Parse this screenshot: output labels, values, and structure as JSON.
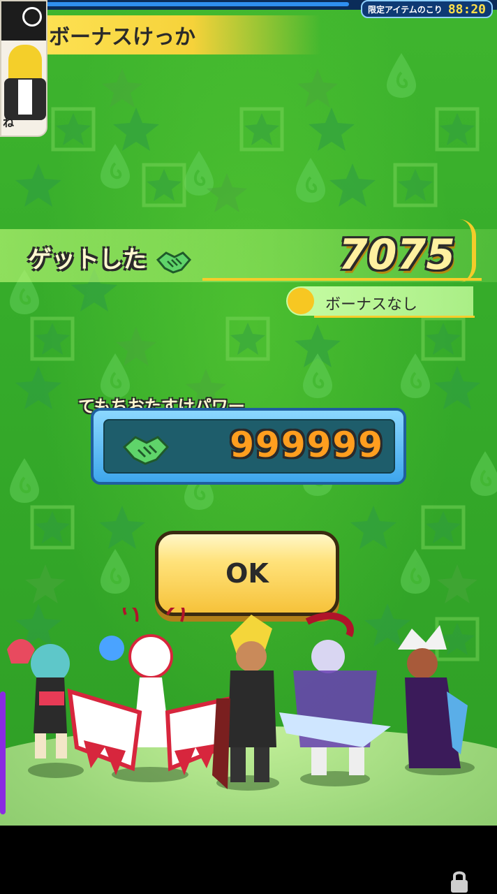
{
  "header": {
    "result_title": "ボーナスけっか",
    "timer_label": "限定アイテムのこり",
    "timer_value": "88:20",
    "portrait_caption": "ね"
  },
  "reward": {
    "get_label": "ゲットした",
    "get_value": "7075",
    "bonus_text": "ボーナスなし"
  },
  "power": {
    "label": "てもちおたすけパワー",
    "value": "999999"
  },
  "buttons": {
    "ok_label": "OK"
  },
  "colors": {
    "background": "#35ab2a",
    "accent_yellow": "#f5cc2a",
    "panel_blue": "#3ea6ec",
    "value_orange": "#ff9e1f"
  },
  "icons": [
    "handshake-icon",
    "lock-icon",
    "clock-icon"
  ]
}
